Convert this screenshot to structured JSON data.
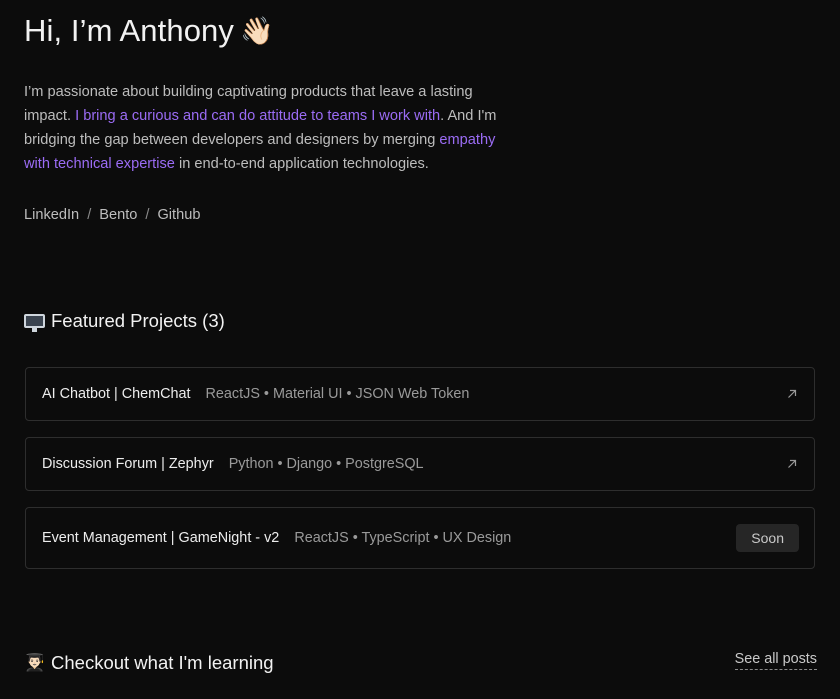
{
  "hero": {
    "title": "Hi, I’m Anthony",
    "wave_emoji": "👋🏻",
    "intro_1": "I’m passionate about building captivating products that leave a lasting impact. ",
    "intro_hl_1": "I bring a curious and can do attitude to teams I work with",
    "intro_2": ". And I'm bridging the gap between developers and designers by merging ",
    "intro_hl_2": "empathy with technical expertise",
    "intro_3": " in end-to-end application technologies.",
    "highlight_color": "#9b6cf5"
  },
  "socials": {
    "linkedin": "LinkedIn",
    "bento": "Bento",
    "github": "Github",
    "separator": "/"
  },
  "featured": {
    "icon": "desktop-monitor-icon",
    "title": "Featured Projects (3)",
    "projects": [
      {
        "name": "AI Chatbot | ChemChat",
        "tags": "ReactJS • Material UI • JSON Web Token",
        "action_icon": "external-arrow-icon"
      },
      {
        "name": "Discussion Forum | Zephyr",
        "tags": "Python • Django • PostgreSQL",
        "action_icon": "external-arrow-icon"
      },
      {
        "name": "Event Management | GameNight - v2",
        "tags": "ReactJS • TypeScript • UX Design",
        "badge": "Soon"
      }
    ]
  },
  "learning": {
    "emoji": "👨🏻‍🎓",
    "title": "Checkout what I'm learning",
    "see_all": "See all posts"
  }
}
